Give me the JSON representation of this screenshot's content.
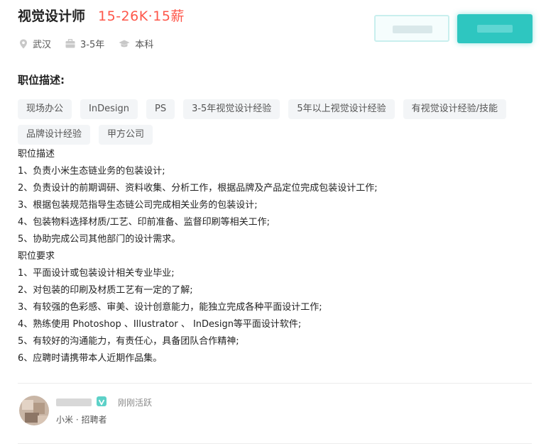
{
  "job": {
    "title": "视觉设计师",
    "salary": "15-26K·15薪"
  },
  "meta": {
    "location": "武汉",
    "experience": "3-5年",
    "education": "本科"
  },
  "section_title": "职位描述:",
  "tags": [
    "现场办公",
    "InDesign",
    "PS",
    "3-5年视觉设计经验",
    "5年以上视觉设计经验",
    "有视觉设计经验/技能",
    "品牌设计经验",
    "甲方公司"
  ],
  "description": [
    "职位描述",
    "1、负责小米生态链业务的包装设计;",
    "2、负责设计的前期调研、资料收集、分析工作，根据品牌及产品定位完成包装设计工作;",
    "3、根据包装规范指导生态链公司完成相关业务的包装设计;",
    "4、包装物料选择材质/工艺、印前准备、监督印刷等相关工作;",
    "5、协助完成公司其他部门的设计需求。",
    "职位要求",
    "1、平面设计或包装设计相关专业毕业;",
    "2、对包装的印刷及材质工艺有一定的了解;",
    "3、有较强的色彩感、审美、设计创意能力，能独立完成各种平面设计工作;",
    "4、熟练使用 Photoshop 、Illustrator 、 InDesign等平面设计软件;",
    "5、有较好的沟通能力，有责任心，具备团队合作精神;",
    "6、应聘时请携带本人近期作品集。"
  ],
  "recruiter": {
    "status": "刚刚活跃",
    "company_role": "小米 · 招聘者"
  },
  "colors": {
    "salary": "#fe574a",
    "primary": "#2ec6c0"
  },
  "icons": {
    "location": "location-pin-icon",
    "experience": "briefcase-icon",
    "education": "graduation-cap-icon",
    "verify": "verified-badge-icon"
  }
}
